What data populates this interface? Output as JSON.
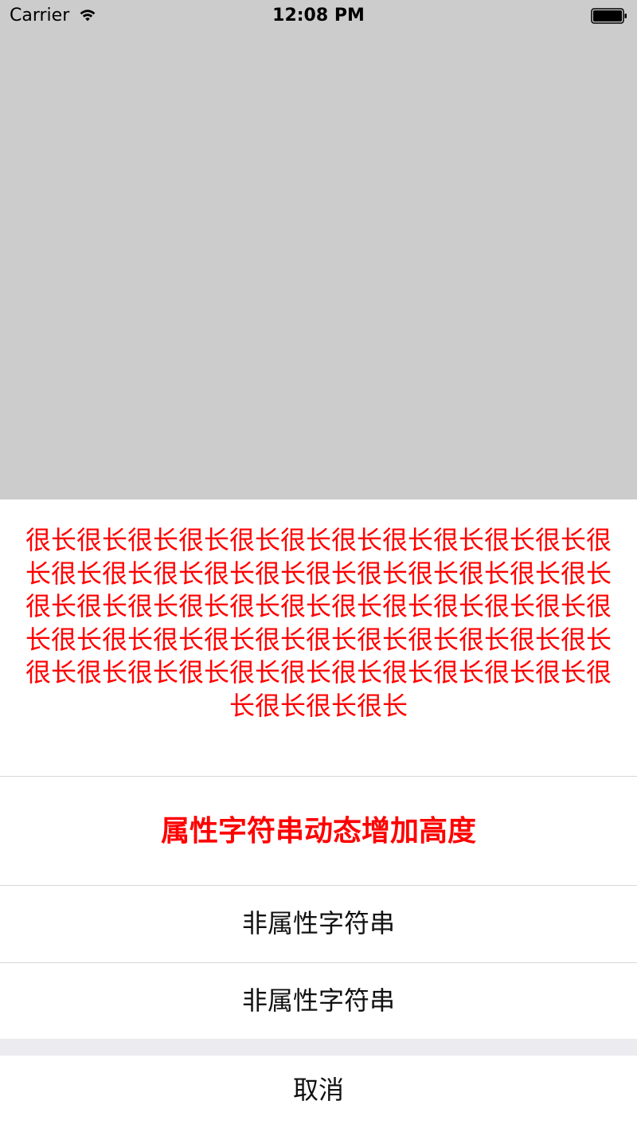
{
  "status_bar": {
    "carrier": "Carrier",
    "time": "12:08 PM",
    "icons": [
      "wifi-icon",
      "battery-icon"
    ]
  },
  "action_sheet": {
    "message": "很长很长很长很长很长很长很长很长很长很长很长很长很长很长很长很长很长很长很长很长很长很长很长很长很长很长很长很长很长很长很长很长很长很长很长很长很长很长很长很长很长很长很长很长很长很长很长很长很长很长很长很长很长很长很长很长很长很长很长很长很长",
    "actions": [
      {
        "label": "属性字符串动态增加高度"
      },
      {
        "label": "非属性字符串"
      },
      {
        "label": "非属性字符串"
      }
    ],
    "cancel_label": "取消",
    "colors": {
      "accent": "#ff0000",
      "dim_background": "#cccccc",
      "sheet_background": "#ffffff"
    }
  }
}
